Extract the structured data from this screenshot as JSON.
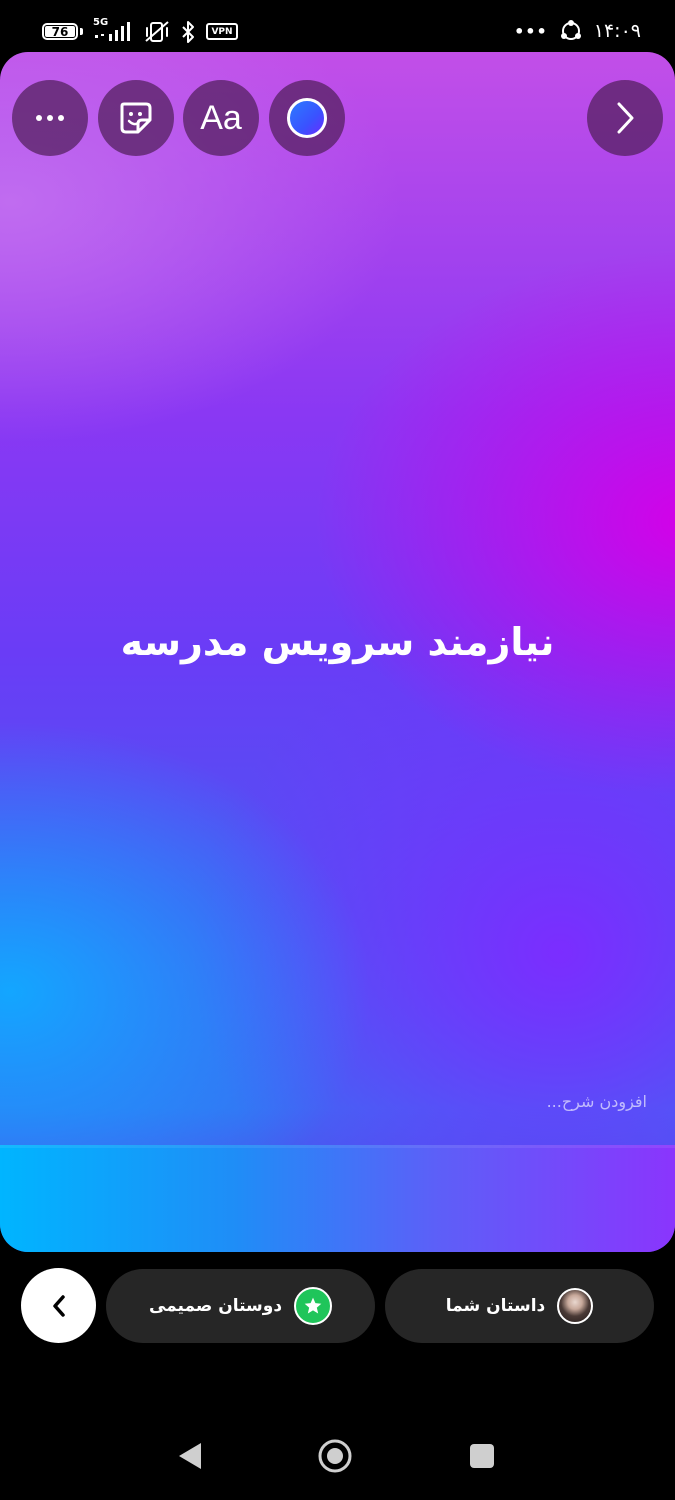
{
  "status_bar": {
    "battery": "76",
    "network": "5G",
    "vpn": "VPN",
    "more": "•••",
    "time": "۱۴:۰۹"
  },
  "toolbar": {
    "more_icon": "more-horizontal-icon",
    "sticker_icon": "sticker-icon",
    "text_label": "Aa",
    "color_icon": "color-picker-icon",
    "next_icon": "chevron-right-icon"
  },
  "story": {
    "text": "نیازمند سرویس مدرسه",
    "caption_placeholder": "افزودن شرح...",
    "gradient": [
      "#c24fe8",
      "#d400e8",
      "#6a3cf6",
      "#13a6ff"
    ]
  },
  "share": {
    "back_icon": "chevron-left-icon",
    "close_friends_label": "دوستان صمیمی",
    "close_friends_color": "#1fc55a",
    "your_story_label": "داستان شما"
  },
  "nav": {
    "back_icon": "triangle-back-icon",
    "home_icon": "circle-home-icon",
    "recents_icon": "square-recents-icon"
  }
}
